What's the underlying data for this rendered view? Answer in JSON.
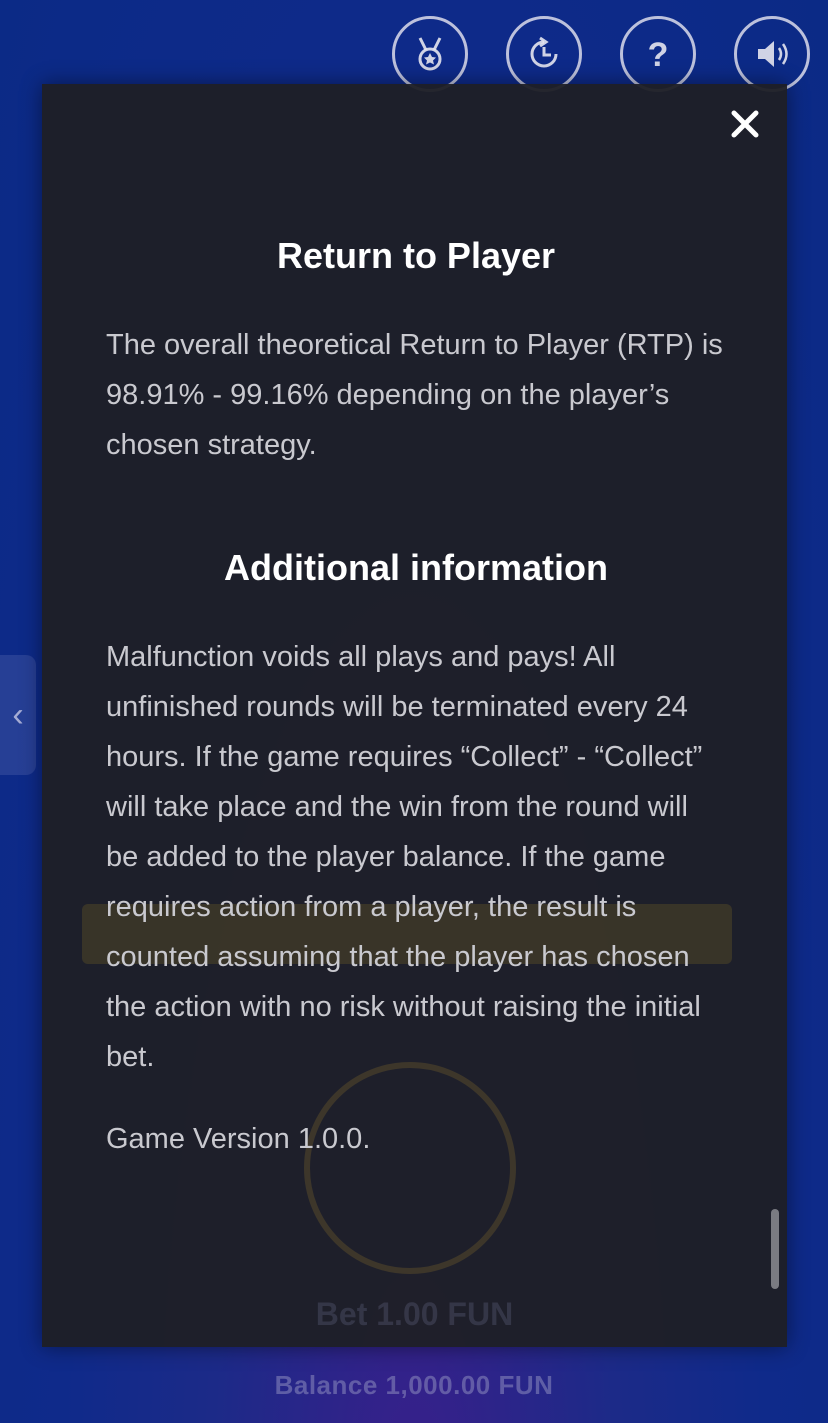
{
  "top_bar": {
    "icons": [
      "medal-icon",
      "history-icon",
      "help-icon",
      "sound-icon"
    ]
  },
  "left_tab": {
    "icon": "chevron-left-icon",
    "glyph": "‹"
  },
  "background": {
    "bet_label": "Bet 1.00 FUN",
    "balance_label": "Balance 1,000.00 FUN"
  },
  "modal": {
    "close_icon": "close-icon",
    "rtp": {
      "title": "Return to Player",
      "body": "The overall theoretical Return to Player (RTP) is 98.91% - 99.16% depending on the player’s chosen strategy."
    },
    "additional": {
      "title": "Additional information",
      "body": "Malfunction voids all plays and pays! All unfinished rounds will be terminated every 24 hours. If the game requires “Collect” - “Collect” will take place and the win from the round will be added to the player balance. If the game requires action from a player, the result is counted assuming that the player has chosen the action with no risk without raising the initial bet."
    },
    "version": "Game Version 1.0.0."
  },
  "colors": {
    "modal_bg": "#1e1f26",
    "title": "#ffffff",
    "text": "#c9c9cf"
  }
}
